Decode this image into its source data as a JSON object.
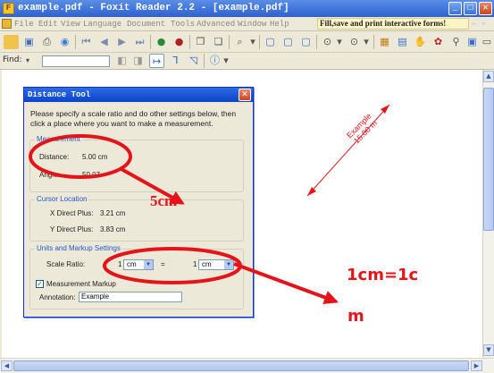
{
  "window": {
    "title": "example.pdf - Foxit Reader 2.2 - [example.pdf]",
    "controls": {
      "minimize": "_",
      "maximize": "□",
      "close": "✕"
    }
  },
  "menubar": {
    "items": [
      "File",
      "Edit",
      "View",
      "Language",
      "Document",
      "Tools",
      "Advanced",
      "Window",
      "Help"
    ],
    "forms_banner": "Fill,save and print interactive forms!"
  },
  "toolbar2": {
    "find_label": "Find:",
    "find_dropdown": "▾",
    "find_value": ""
  },
  "dialog": {
    "title": "Distance Tool",
    "close": "✕",
    "intro": "Please specify a scale ratio and do other settings below, then click a place where you want to make a measurement.",
    "measurement": {
      "title": "Measurement",
      "distance_label": "Distance:",
      "distance_value": "5.00 cm",
      "angle_label": "Angle:",
      "angle_value": "50.07"
    },
    "cursor": {
      "title": "Cursor Location",
      "x_label": "X Direct Plus:",
      "x_value": "3.21 cm",
      "y_label": "Y Direct Plus:",
      "y_value": "3.83 cm"
    },
    "units": {
      "title": "Units and Markup Settings",
      "scale_label": "Scale Ratio:",
      "scale_left_num": "1",
      "scale_left_unit": "cm",
      "equals": "=",
      "scale_right_num": "1",
      "scale_right_unit": "cm",
      "measurement_checkbox_label": "Measurement Markup",
      "measurement_checked": true,
      "annotation_label": "Annotation:",
      "annotation_value": "Example"
    }
  },
  "document": {
    "example_line1": "Example",
    "example_line2": "15.00 m"
  },
  "annotations": {
    "five_cm": "5cm",
    "one_cm_line1": "1cm=1c",
    "one_cm_line2": "m",
    "color": "#e4141b"
  },
  "colors": {
    "titlebar": "#2d62cf",
    "chrome": "#ece9d8",
    "dialog_title": "#0a44c8"
  }
}
